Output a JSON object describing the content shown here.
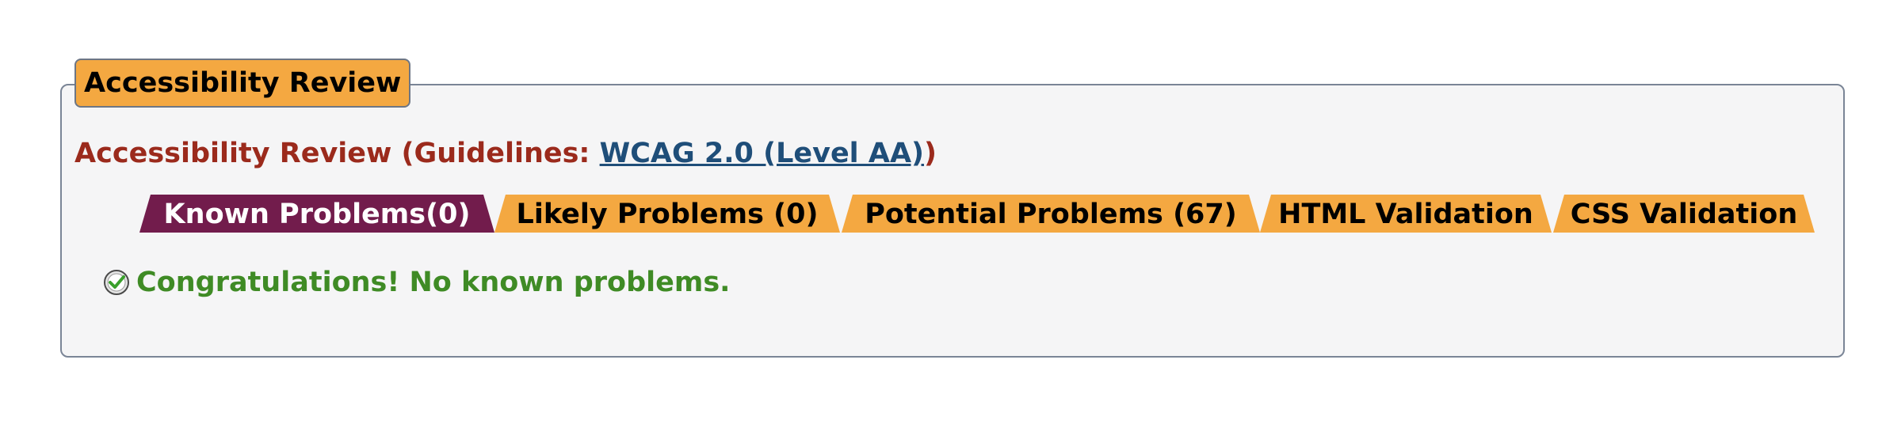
{
  "review": {
    "legend": "Accessibility Review",
    "guidelines_prefix": "Accessibility Review (Guidelines: ",
    "guidelines_link": "WCAG 2.0 (Level AA)",
    "guidelines_suffix": ")"
  },
  "tabs": [
    {
      "label": "Known Problems(0)",
      "active": true
    },
    {
      "label": "Likely Problems (0)",
      "active": false
    },
    {
      "label": "Potential Problems (67)",
      "active": false
    },
    {
      "label": "HTML Validation",
      "active": false
    },
    {
      "label": "CSS Validation",
      "active": false
    }
  ],
  "result": {
    "icon": "check-circle-icon",
    "message": "Congratulations! No known problems."
  },
  "colors": {
    "tab_active": "#721c4c",
    "tab_inactive": "#f4a841",
    "heading_red": "#9b2a1c",
    "link_blue": "#1f4e79",
    "success_green": "#3f8b25"
  }
}
